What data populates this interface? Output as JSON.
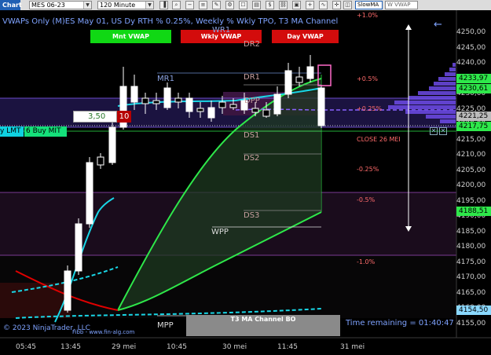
{
  "toolbar": {
    "tab_label": "Chart",
    "instrument": "MES 06-23",
    "interval": "120 Minute",
    "slow_ma_label": "SlowMA",
    "w_vwap_label": "W VWAP"
  },
  "header": {
    "indicator_title": "VWAPs Only (M)ES May 01, US Dy RTH % 0.25%, Weekly %   Wkly TPO, T3 MA Channel",
    "top_pct_label": "+1.0%"
  },
  "vwap_buttons": {
    "mnt": "Mnt VWAP",
    "wkly": "Wkly VWAP",
    "day": "Day VWAP"
  },
  "levels": {
    "dr2": "DR2",
    "wr1": "WR1",
    "dr1": "DR1",
    "mr1": "MR1",
    "dpp": "DPP",
    "ds1": "DS1",
    "ds2": "DS2",
    "ds3": "DS3",
    "wpp": "WPP",
    "mpp": "MPP"
  },
  "pct_labels": [
    "+0.5%",
    "+0.25%",
    "-0.25%",
    "-0.5%",
    "-1.0%"
  ],
  "close_label": "CLOSE 26 MEI",
  "order_panel": {
    "quantity": "3,50",
    "qty_badge": "10",
    "buy_lmt_label": "y LMT",
    "buy_mit_label": "6  Buy MIT"
  },
  "bottom": {
    "copyright": "© 2023 NinjaTrader, LLC",
    "watermark": "Fibb - www.fin-alg.com",
    "channel_label": "T3 MA Channel BO",
    "time_remaining": "Time remaining = 01:40:47"
  },
  "price_axis": {
    "ticks": [
      "4250,00",
      "4245,00",
      "4240,00",
      "4235,00",
      "4230,00",
      "4225,00",
      "4220,00",
      "4215,00",
      "4210,00",
      "4205,00",
      "4200,00",
      "4195,00",
      "4190,00",
      "4185,00",
      "4180,00",
      "4175,00",
      "4170,00",
      "4165,00",
      "4160,00",
      "4155,00"
    ],
    "tags": [
      {
        "label": "4233,97",
        "color": "#2ee84a"
      },
      {
        "label": "4230,61",
        "color": "#2ee84a"
      },
      {
        "label": "4221,25",
        "color": "#bcbcbc"
      },
      {
        "label": "4217,75",
        "color": "#2ee84a"
      },
      {
        "label": "4188,51",
        "color": "#2ee84a"
      },
      {
        "label": "4154,50",
        "color": "#8ad8ff"
      }
    ]
  },
  "time_axis": {
    "labels": [
      "05:45",
      "13:45",
      "29 mei",
      "10:45",
      "30 mei",
      "11:45",
      "31 mei"
    ]
  },
  "colors": {
    "bull_candle": "#ffffff",
    "vwap_green": "#2ee84a",
    "t3_cyan": "#19d6e6",
    "accent_red": "#e00000",
    "level_text": "#c8a0a0"
  }
}
